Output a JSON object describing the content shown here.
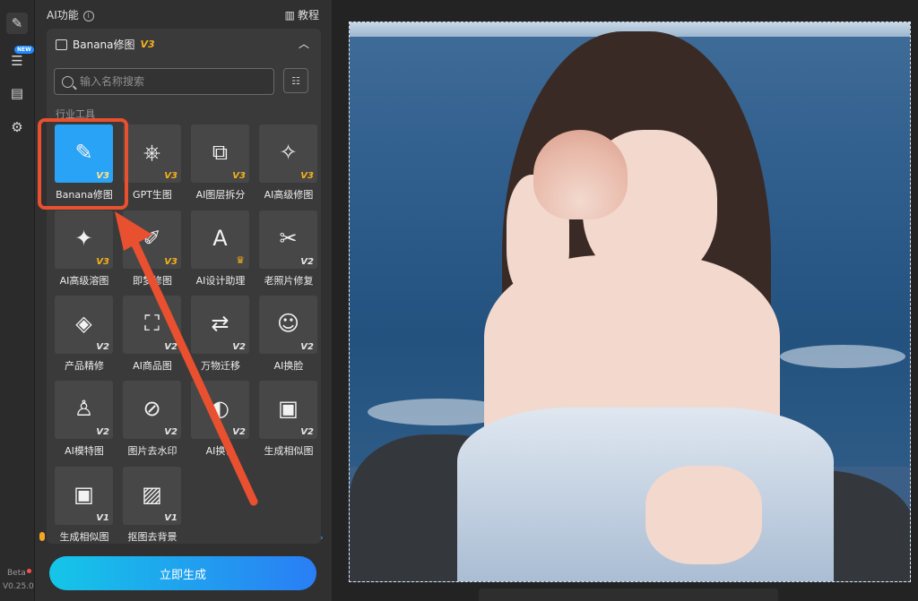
{
  "panel": {
    "title": "AI功能",
    "tutorial_label": "教程"
  },
  "rail": {
    "new_badge": "NEW",
    "beta": "Beta",
    "version": "V0.25.0"
  },
  "card": {
    "title": "Banana修图",
    "version": "V3"
  },
  "search": {
    "placeholder": "输入名称搜索",
    "value": ""
  },
  "section_label": "行业工具",
  "tools": [
    {
      "label": "Banana修图",
      "version": "V3",
      "icon": "image-edit-icon",
      "glyph": "✎",
      "active": true
    },
    {
      "label": "GPT生图",
      "version": "V3",
      "icon": "openai-icon",
      "glyph": "⎈"
    },
    {
      "label": "AI图层拆分",
      "version": "V3",
      "icon": "layers-split-icon",
      "glyph": "⧉"
    },
    {
      "label": "AI高级修图",
      "version": "V3",
      "icon": "magic-wand-icon",
      "glyph": "✧"
    },
    {
      "label": "AI高级溶图",
      "version": "V3",
      "icon": "image-sparkle-icon",
      "glyph": "✦"
    },
    {
      "label": "即梦修图",
      "version": "V3",
      "icon": "brush-icon",
      "glyph": "✐"
    },
    {
      "label": "AI设计助理",
      "version": "",
      "icon": "design-assistant-icon",
      "glyph": "A",
      "crown": true
    },
    {
      "label": "老照片修复",
      "version": "V2",
      "icon": "photo-repair-icon",
      "glyph": "✂"
    },
    {
      "label": "产品精修",
      "version": "V2",
      "icon": "diamond-icon",
      "glyph": "◈"
    },
    {
      "label": "AI商品图",
      "version": "V2",
      "icon": "shopping-bag-icon",
      "glyph": "⛶"
    },
    {
      "label": "万物迁移",
      "version": "V2",
      "icon": "transfer-icon",
      "glyph": "⇄"
    },
    {
      "label": "AI换脸",
      "version": "V2",
      "icon": "face-swap-icon",
      "glyph": "☺"
    },
    {
      "label": "AI模特图",
      "version": "V2",
      "icon": "model-icon",
      "glyph": "♙"
    },
    {
      "label": "图片去水印",
      "version": "V2",
      "icon": "watermark-remove-icon",
      "glyph": "⊘"
    },
    {
      "label": "AI换色",
      "version": "V2",
      "icon": "color-swap-icon",
      "glyph": "◐"
    },
    {
      "label": "生成相似图",
      "version": "V2",
      "icon": "similar-image-icon",
      "glyph": "▣"
    },
    {
      "label": "生成相似图",
      "version": "V1",
      "icon": "similar-image-icon",
      "glyph": "▣"
    },
    {
      "label": "抠图去背景",
      "version": "V1",
      "icon": "background-remove-icon",
      "glyph": "▨"
    }
  ],
  "generate_button": "立即生成",
  "colors": {
    "accent_active": "#29a3f5",
    "version_badge": "#f5b01a",
    "annotation": "#e8502f",
    "generate_gradient": [
      "#15c6e8",
      "#2a7ef5"
    ]
  }
}
